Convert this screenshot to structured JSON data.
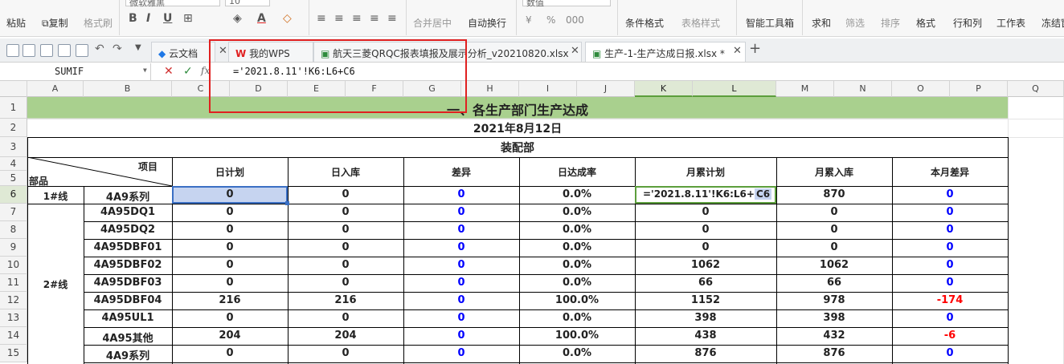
{
  "ribbon": {
    "paste": "粘贴",
    "copy": "复制",
    "format_painter": "格式刷",
    "font_name": "微软雅黑",
    "font_size": "10",
    "merge_center": "合并居中",
    "wrap_text": "自动换行",
    "number_format": "数值",
    "cond_format": "条件格式",
    "table_style": "表格样式",
    "smart_tools": "智能工具箱",
    "sum": "求和",
    "filter": "筛选",
    "sort": "排序",
    "format": "格式",
    "row_col": "行和列",
    "worksheet": "工作表",
    "freeze": "冻结窗",
    "bold": "B",
    "italic": "I",
    "underline": "U",
    "percent": "%",
    "comma": "000"
  },
  "tabs": [
    {
      "label": "云文档"
    },
    {
      "label": "我的WPS"
    },
    {
      "label": "航天三菱QRQC报表填报及展示分析_v20210820.xlsx"
    },
    {
      "label": "生产-1-生产达成日报.xlsx *"
    }
  ],
  "formula_bar": {
    "name_box": "SUMIF",
    "formula": "='2021.8.11'!K6:L6+C6",
    "ref_hl": "C6",
    "cancel": "✕",
    "confirm": "✓",
    "fx": "fx"
  },
  "columns": [
    "A",
    "B",
    "C",
    "D",
    "E",
    "F",
    "G",
    "H",
    "I",
    "J",
    "K",
    "L",
    "M",
    "N",
    "O",
    "P",
    "Q"
  ],
  "rows": [
    "1",
    "2",
    "3",
    "4",
    "5",
    "6",
    "7",
    "8",
    "9",
    "10",
    "11",
    "12",
    "13",
    "14",
    "15"
  ],
  "sheet": {
    "title": "一、各生产部门生产达成",
    "date": "2021年8月12日",
    "dept": "装配部",
    "header_item": "项目",
    "header_dept": "部品",
    "headers": [
      "日计划",
      "日入库",
      "差异",
      "日达成率",
      "月累计划",
      "月累入库",
      "本月差异"
    ],
    "group1": "1#线",
    "group2": "2#线",
    "edit_cell": "='2021.8.11'!K6:L6+",
    "edit_ref": "C6",
    "data_rows": [
      {
        "item": "4A9系列",
        "plan": "0",
        "in": "0",
        "diff": "0",
        "rate": "0.0%",
        "mplan": "",
        "min": "870",
        "mdiff": "0"
      },
      {
        "item": "4A95DQ1",
        "plan": "0",
        "in": "0",
        "diff": "0",
        "rate": "0.0%",
        "mplan": "0",
        "min": "0",
        "mdiff": "0"
      },
      {
        "item": "4A95DQ2",
        "plan": "0",
        "in": "0",
        "diff": "0",
        "rate": "0.0%",
        "mplan": "0",
        "min": "0",
        "mdiff": "0"
      },
      {
        "item": "4A95DBF01",
        "plan": "0",
        "in": "0",
        "diff": "0",
        "rate": "0.0%",
        "mplan": "0",
        "min": "0",
        "mdiff": "0"
      },
      {
        "item": "4A95DBF02",
        "plan": "0",
        "in": "0",
        "diff": "0",
        "rate": "0.0%",
        "mplan": "1062",
        "min": "1062",
        "mdiff": "0"
      },
      {
        "item": "4A95DBF03",
        "plan": "0",
        "in": "0",
        "diff": "0",
        "rate": "0.0%",
        "mplan": "66",
        "min": "66",
        "mdiff": "0"
      },
      {
        "item": "4A95DBF04",
        "plan": "216",
        "in": "216",
        "diff": "0",
        "rate": "100.0%",
        "mplan": "1152",
        "min": "978",
        "mdiff": "-174"
      },
      {
        "item": "4A95UL1",
        "plan": "0",
        "in": "0",
        "diff": "0",
        "rate": "0.0%",
        "mplan": "398",
        "min": "398",
        "mdiff": "0"
      },
      {
        "item": "4A95其他",
        "plan": "204",
        "in": "204",
        "diff": "0",
        "rate": "100.0%",
        "mplan": "438",
        "min": "432",
        "mdiff": "-6"
      },
      {
        "item": "4A9系列",
        "plan": "0",
        "in": "0",
        "diff": "0",
        "rate": "0.0%",
        "mplan": "876",
        "min": "876",
        "mdiff": "0"
      }
    ]
  },
  "colors": {
    "title_fill": "#a9d08e",
    "accent": "#5c9e3c",
    "highlight": "#e02020",
    "blue": "#0000ff",
    "red": "#ff0000"
  }
}
